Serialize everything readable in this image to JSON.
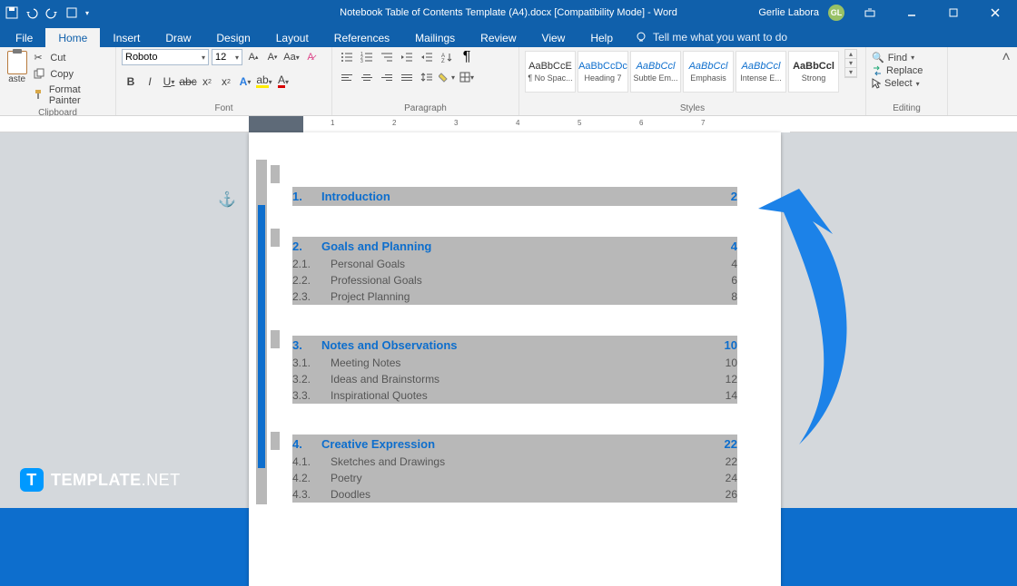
{
  "titlebar": {
    "document_title": "Notebook Table of Contents Template (A4).docx [Compatibility Mode]  -  Word",
    "username": "Gerlie Labora",
    "user_initials": "GL"
  },
  "tabs": {
    "file": "File",
    "home": "Home",
    "insert": "Insert",
    "draw": "Draw",
    "design": "Design",
    "layout": "Layout",
    "references": "References",
    "mailings": "Mailings",
    "review": "Review",
    "view": "View",
    "help": "Help",
    "tellme": "Tell me what you want to do"
  },
  "ribbon": {
    "clipboard": {
      "label": "Clipboard",
      "paste": "aste",
      "cut": "Cut",
      "copy": "Copy",
      "format_painter": "Format Painter"
    },
    "font": {
      "label": "Font",
      "name": "Roboto",
      "size": "12"
    },
    "paragraph": {
      "label": "Paragraph"
    },
    "styles": {
      "label": "Styles",
      "items": [
        {
          "sample": "AaBbCcE",
          "name": "¶ No Spac...",
          "cls": ""
        },
        {
          "sample": "AaBbCcDc",
          "name": "Heading 7",
          "cls": "blue"
        },
        {
          "sample": "AaBbCcl",
          "name": "Subtle Em...",
          "cls": "italicblue"
        },
        {
          "sample": "AaBbCcl",
          "name": "Emphasis",
          "cls": "italicblue"
        },
        {
          "sample": "AaBbCcl",
          "name": "Intense E...",
          "cls": "italicblue"
        },
        {
          "sample": "AaBbCcl",
          "name": "Strong",
          "cls": "bold"
        }
      ]
    },
    "editing": {
      "label": "Editing",
      "find": "Find",
      "replace": "Replace",
      "select": "Select"
    }
  },
  "ruler": {
    "nums": [
      "1",
      "2",
      "3",
      "4",
      "5",
      "6",
      "7"
    ]
  },
  "toc": {
    "s1": {
      "num": "1.",
      "title": "Introduction",
      "page": "2"
    },
    "s2": {
      "num": "2.",
      "title": "Goals and Planning",
      "page": "4",
      "subs": [
        {
          "n": "2.1.",
          "t": "Personal Goals",
          "p": "4"
        },
        {
          "n": "2.2.",
          "t": "Professional Goals",
          "p": "6"
        },
        {
          "n": "2.3.",
          "t": "Project Planning",
          "p": "8"
        }
      ]
    },
    "s3": {
      "num": "3.",
      "title": "Notes and Observations",
      "page": "10",
      "subs": [
        {
          "n": "3.1.",
          "t": "Meeting Notes",
          "p": "10"
        },
        {
          "n": "3.2.",
          "t": "Ideas and Brainstorms",
          "p": "12"
        },
        {
          "n": "3.3.",
          "t": "Inspirational Quotes",
          "p": "14"
        }
      ]
    },
    "s4": {
      "num": "4.",
      "title": "Creative Expression",
      "page": "22",
      "subs": [
        {
          "n": "4.1.",
          "t": "Sketches and Drawings",
          "p": "22"
        },
        {
          "n": "4.2.",
          "t": "Poetry",
          "p": "24"
        },
        {
          "n": "4.3.",
          "t": "Doodles",
          "p": "26"
        }
      ]
    }
  },
  "watermark": {
    "brand": "TEMPLATE",
    "suffix": ".NET",
    "badge": "T"
  }
}
